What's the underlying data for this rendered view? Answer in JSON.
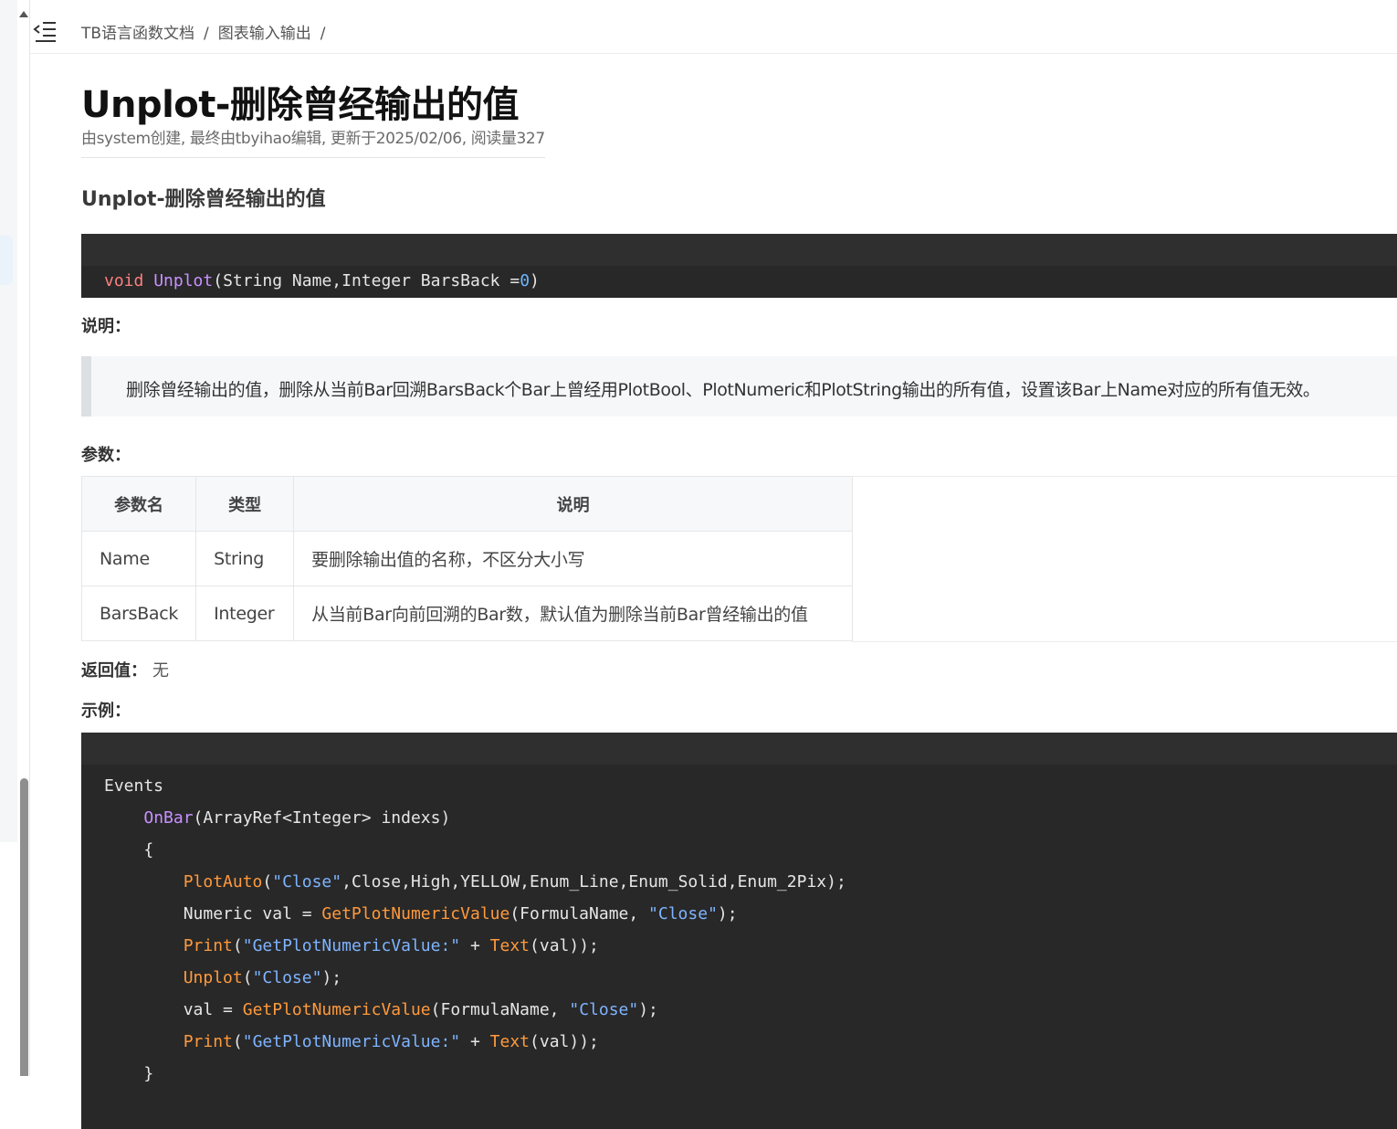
{
  "breadcrumb": [
    "TB语言函数文档",
    "图表输入输出"
  ],
  "breadcrumb_sep": "/",
  "title": "Unplot-删除曾经输出的值",
  "meta": "由system创建, 最终由tbyihao编辑, 更新于2025/02/06, 阅读量327",
  "section_title": "Unplot-删除曾经输出的值",
  "signature": {
    "kw": "void",
    "fn": "Unplot",
    "args": "(String Name,Integer BarsBack =",
    "default": "0",
    "close": ")"
  },
  "labels": {
    "desc": "说明：",
    "params": "参数：",
    "return": "返回值：",
    "return_value": "无",
    "example": "示例："
  },
  "description": "删除曾经输出的值，删除从当前Bar回溯BarsBack个Bar上曾经用PlotBool、PlotNumeric和PlotString输出的所有值，设置该Bar上Name对应的所有值无效。",
  "table": {
    "headers": [
      "参数名",
      "类型",
      "说明"
    ],
    "rows": [
      [
        "Name",
        "String",
        "要删除输出值的名称，不区分大小写"
      ],
      [
        "BarsBack",
        "Integer",
        "从当前Bar向前回溯的Bar数，默认值为删除当前Bar曾经输出的值"
      ]
    ]
  },
  "example_code": {
    "l1": "Events",
    "l2_fn": "OnBar",
    "l2_rest": "(ArrayRef<Integer> indexs)",
    "l3": "{",
    "l4_call": "PlotAuto",
    "l4_p1": "(",
    "l4_str": "\"Close\"",
    "l4_rest": ",Close,High,YELLOW,Enum_Line,Enum_Solid,Enum_2Pix);",
    "l5_a": "Numeric val = ",
    "l5_call": "GetPlotNumericValue",
    "l5_b": "(FormulaName, ",
    "l5_str": "\"Close\"",
    "l5_c": ");",
    "l6_call": "Print",
    "l6_a": "(",
    "l6_str": "\"GetPlotNumericValue:\"",
    "l6_b": " + ",
    "l6_call2": "Text",
    "l6_c": "(val));",
    "l7_call": "Unplot",
    "l7_a": "(",
    "l7_str": "\"Close\"",
    "l7_b": ");",
    "l8_a": "val = ",
    "l8_call": "GetPlotNumericValue",
    "l8_b": "(FormulaName, ",
    "l8_str": "\"Close\"",
    "l8_c": ");",
    "l9_call": "Print",
    "l9_a": "(",
    "l9_str": "\"GetPlotNumericValue:\"",
    "l9_b": " + ",
    "l9_call2": "Text",
    "l9_c": "(val));",
    "l10": "}"
  },
  "colors": {
    "code_bg": "#282828",
    "keyword": "#fe7f7f",
    "function": "#c791ff",
    "call": "#ff9a3c",
    "string": "#7fb4ff"
  }
}
